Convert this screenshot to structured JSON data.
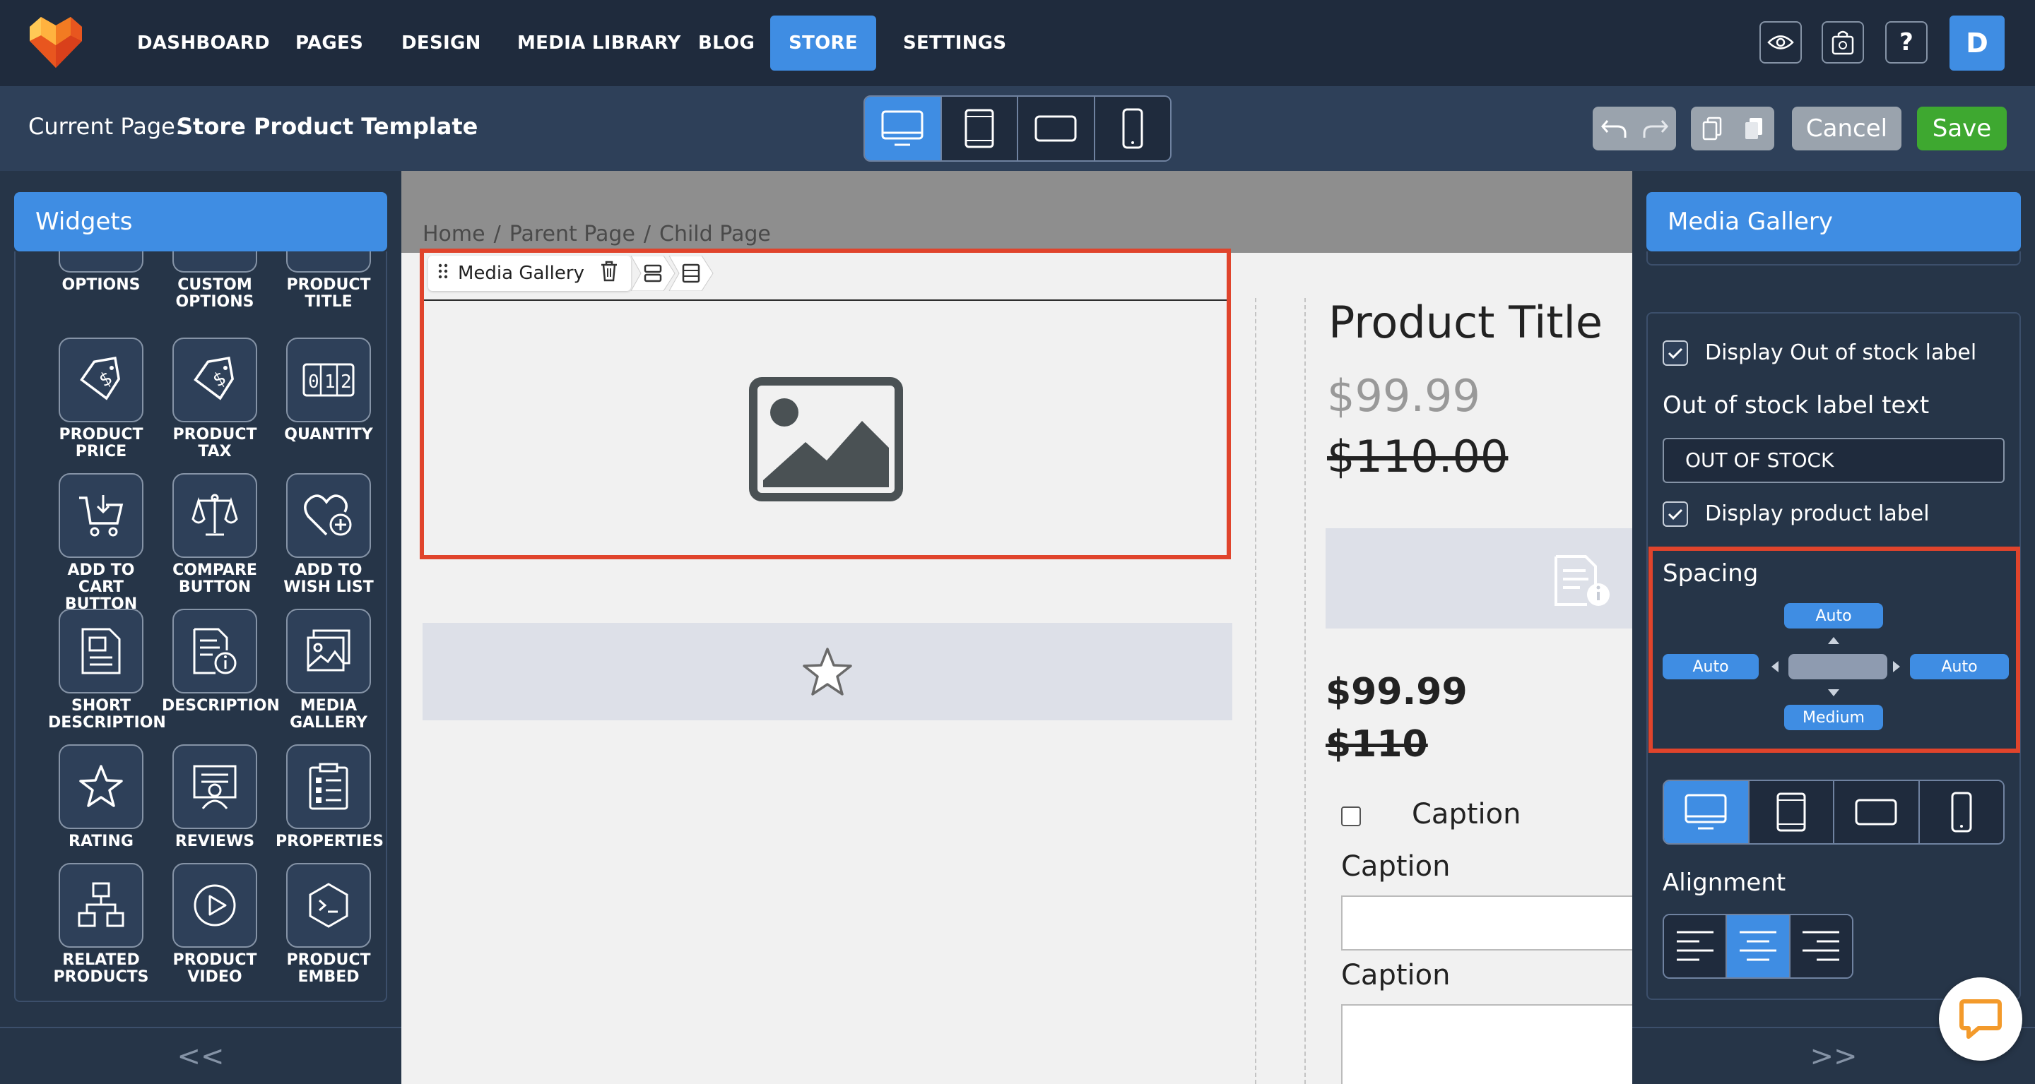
{
  "nav": {
    "items": [
      "DASHBOARD",
      "PAGES",
      "DESIGN",
      "MEDIA LIBRARY",
      "BLOG",
      "STORE",
      "SETTINGS"
    ],
    "active": "STORE",
    "help": "?",
    "avatar": "D"
  },
  "toolbar": {
    "current_page_label": "Current Page:",
    "current_page_value": "Store Product Template",
    "cancel_label": "Cancel",
    "save_label": "Save"
  },
  "left_panel": {
    "title": "Widgets",
    "widgets": [
      {
        "label": "OPTIONS",
        "icon": "options-icon"
      },
      {
        "label": "CUSTOM OPTIONS",
        "icon": "custom-options-icon"
      },
      {
        "label": "PRODUCT TITLE",
        "icon": "product-title-icon"
      },
      {
        "label": "PRODUCT PRICE",
        "icon": "price-tag-icon"
      },
      {
        "label": "PRODUCT TAX",
        "icon": "tax-tag-icon"
      },
      {
        "label": "QUANTITY",
        "icon": "quantity-counter-icon"
      },
      {
        "label": "ADD TO CART BUTTON",
        "icon": "cart-icon"
      },
      {
        "label": "COMPARE BUTTON",
        "icon": "scale-icon"
      },
      {
        "label": "ADD TO WISH LIST",
        "icon": "heart-plus-icon"
      },
      {
        "label": "SHORT DESCRIPTION",
        "icon": "document-icon"
      },
      {
        "label": "DESCRIPTION",
        "icon": "document-info-icon"
      },
      {
        "label": "MEDIA GALLERY",
        "icon": "gallery-icon"
      },
      {
        "label": "RATING",
        "icon": "star-icon"
      },
      {
        "label": "REVIEWS",
        "icon": "review-icon"
      },
      {
        "label": "PROPERTIES",
        "icon": "checklist-icon"
      },
      {
        "label": "RELATED PRODUCTS",
        "icon": "hierarchy-icon"
      },
      {
        "label": "PRODUCT VIDEO",
        "icon": "play-icon"
      },
      {
        "label": "PRODUCT EMBED",
        "icon": "embed-icon"
      }
    ],
    "collapse_label": "<<"
  },
  "canvas": {
    "breadcrumb": [
      "Home",
      "Parent Page",
      "Child Page"
    ],
    "breadcrumb_sep": "/",
    "media_gallery_tag": "Media Gallery",
    "product_title": "Product Title",
    "price_sale": "$99.99",
    "price_original": "$110.00",
    "price_sale_2": "$99.99",
    "price_original_2": "$110",
    "captions": [
      "Caption",
      "Caption",
      "Caption"
    ]
  },
  "right_panel": {
    "title": "Media Gallery",
    "display_out_of_stock_label": "Display Out of stock label",
    "out_of_stock_text_label": "Out of stock label text",
    "out_of_stock_text_value": "OUT OF STOCK",
    "display_product_label": "Display product label",
    "spacing_label": "Spacing",
    "spacing": {
      "top": "Auto",
      "left": "Auto",
      "right": "Auto",
      "bottom": "Medium"
    },
    "alignment_label": "Alignment",
    "alignment_active": "center",
    "collapse_label": ">>"
  },
  "colors": {
    "accent": "#3f8de3",
    "save": "#3ea830",
    "highlight": "#e0442c",
    "nav_bg": "#1f2b3d",
    "panel_bg": "#263548"
  }
}
